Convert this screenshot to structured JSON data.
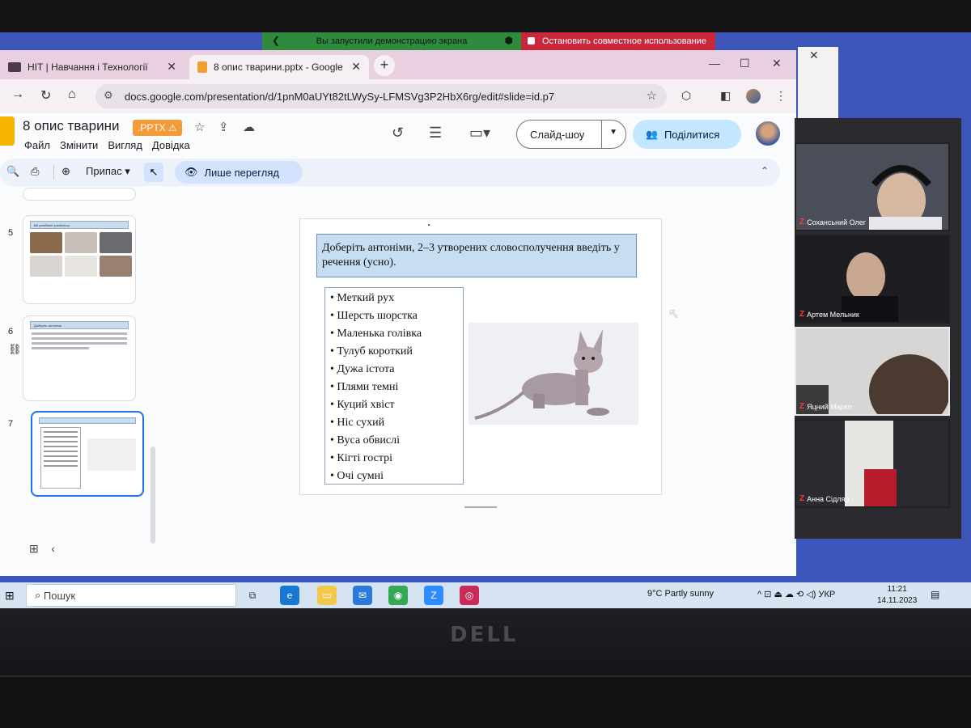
{
  "banner": {
    "screen_share_text": "Вы запустили демонстрацию экрана",
    "stop_share_text": "Остановить совместное использование"
  },
  "browser": {
    "tabs": [
      {
        "label": "НІТ | Навчання і Технології"
      },
      {
        "label": "8 опис тварини.pptx - Google"
      }
    ],
    "url": "docs.google.com/presentation/d/1pnM0aUYt82tLWySy-LFMSVg3P2HbX6rg/edit#slide=id.p7"
  },
  "slides_app": {
    "doc_title": "8 опис тварини",
    "file_badge": ".PPTX",
    "menu": [
      "Файл",
      "Змінити",
      "Вигляд",
      "Довідка"
    ],
    "slideshow_label": "Слайд-шоу",
    "share_label": "Поділитися",
    "zoom_label": "Припас",
    "view_only_label": "Лише перегляд"
  },
  "filmstrip": {
    "slide_numbers": [
      "5",
      "6",
      "7"
    ],
    "slide5_title": "Міі улюблені улюбленці",
    "slide6_title": "Доберіть антоніми"
  },
  "slide": {
    "heading": "Доберіть антоніми, 2–3 утворених словосполучення введіть у речення (усно).",
    "items": [
      "• Меткий рух",
      "• Шерсть шорстка",
      "• Маленька голівка",
      "• Тулуб короткий",
      "• Дужа істота",
      "• Плями темні",
      "• Куций хвіст",
      "•  Ніс сухий",
      "• Вуса обвислі",
      "• Кігті гострі",
      "• Очі сумні"
    ]
  },
  "meet": {
    "participants": [
      {
        "name": "Сохансьний Олег"
      },
      {
        "name": "Артем Мельник"
      },
      {
        "name": "Яцний Марко"
      },
      {
        "name": "Анна Сідляр"
      }
    ]
  },
  "taskbar": {
    "search_placeholder": "Пошук",
    "weather": "9°C  Partly sunny",
    "lang": "УКР",
    "time": "11:21",
    "date": "14.11.2023"
  },
  "hardware": {
    "brand": "DELL"
  },
  "colors": {
    "share_banner": "#2e8b3e",
    "stop_share": "#c8283a",
    "pptx_badge": "#f29b38",
    "share_button": "#c2e7ff",
    "slide_heading_bg": "#c6ddf2"
  }
}
